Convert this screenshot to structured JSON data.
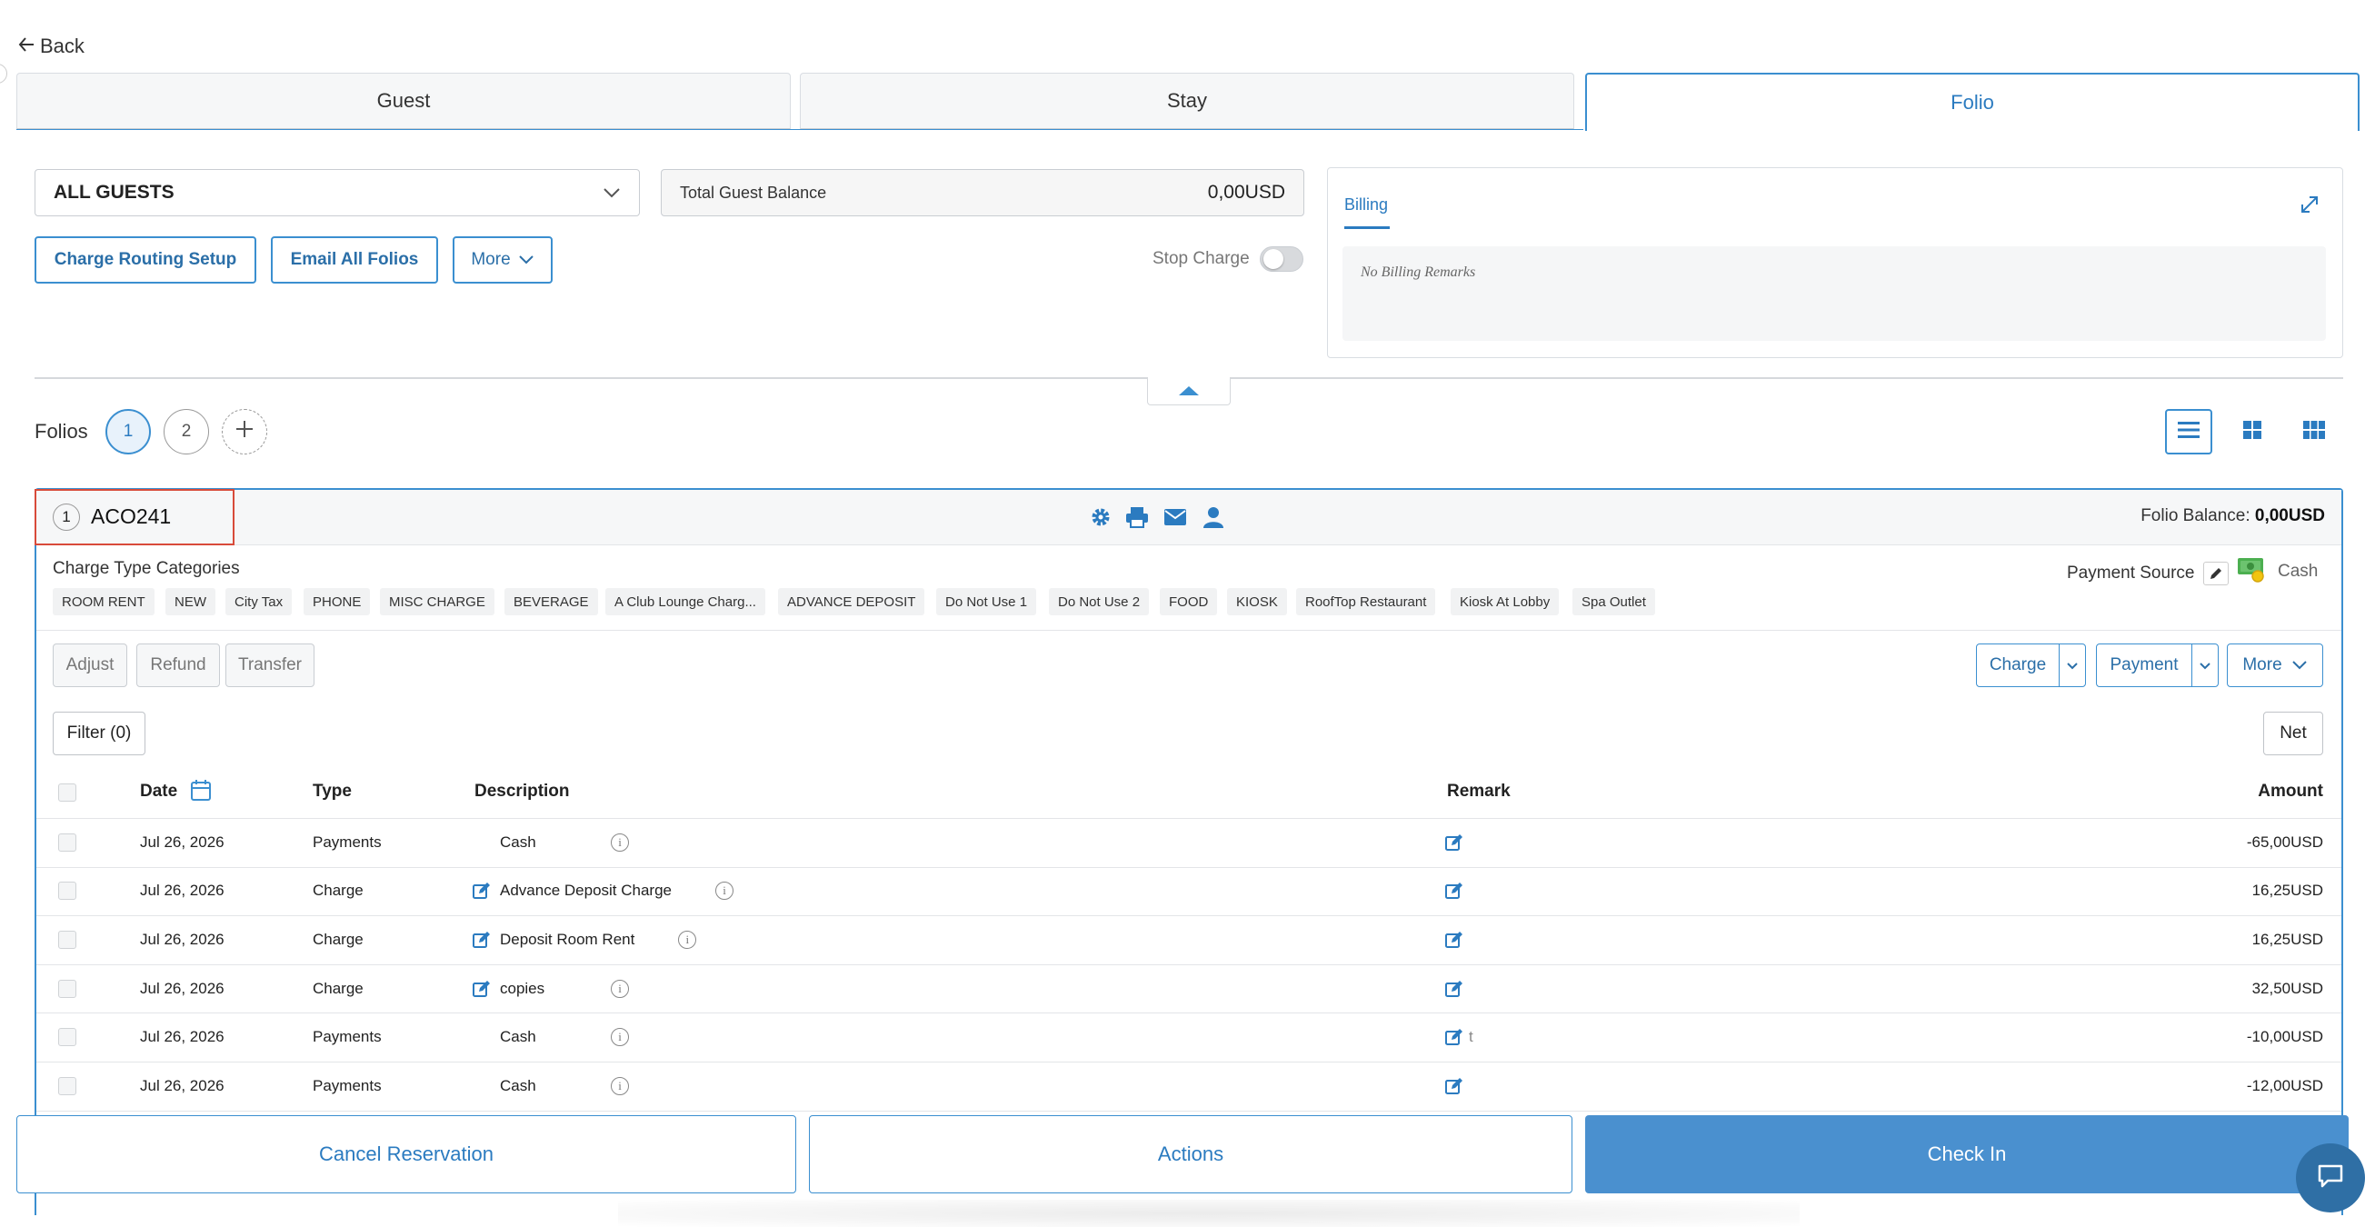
{
  "nav": {
    "back_label": "Back"
  },
  "tabs": [
    {
      "label": "Guest"
    },
    {
      "label": "Stay"
    },
    {
      "label": "Folio"
    }
  ],
  "guest_select": {
    "value": "ALL GUESTS"
  },
  "balance": {
    "label": "Total Guest Balance",
    "value": "0,00USD"
  },
  "actions_row": {
    "charge_routing": "Charge Routing Setup",
    "email_all": "Email All Folios",
    "more": "More",
    "stop_charge": "Stop Charge",
    "stop_charge_on": false
  },
  "billing": {
    "tab": "Billing",
    "remarks": "No Billing Remarks"
  },
  "folios": {
    "label": "Folios",
    "items": [
      "1",
      "2"
    ]
  },
  "folio": {
    "number": "1",
    "name": "ACO241",
    "balance_label": "Folio Balance:",
    "balance_value": "0,00USD",
    "charge_type_label": "Charge Type Categories",
    "categories": [
      "ROOM RENT",
      "NEW",
      "City Tax",
      "PHONE",
      "MISC CHARGE",
      "BEVERAGE",
      "A Club Lounge Charg...",
      "ADVANCE DEPOSIT",
      "Do Not Use 1",
      "Do Not Use 2",
      "FOOD",
      "KIOSK",
      "RoofTop Restaurant",
      "Kiosk At Lobby",
      "Spa Outlet"
    ],
    "payment_source_label": "Payment Source",
    "payment_source_value": "Cash"
  },
  "toolbar": {
    "adjust": "Adjust",
    "refund": "Refund",
    "transfer": "Transfer",
    "charge": "Charge",
    "payment": "Payment",
    "more": "More",
    "filter": "Filter (0)",
    "net": "Net"
  },
  "table": {
    "headers": {
      "date": "Date",
      "type": "Type",
      "description": "Description",
      "remark": "Remark",
      "amount": "Amount"
    },
    "rows": [
      {
        "date": "Jul 26, 2026",
        "type": "Payments",
        "description": "Cash",
        "remark": "",
        "amount": "-65,00USD",
        "editable": false
      },
      {
        "date": "Jul 26, 2026",
        "type": "Charge",
        "description": "Advance Deposit Charge",
        "remark": "",
        "amount": "16,25USD",
        "editable": true
      },
      {
        "date": "Jul 26, 2026",
        "type": "Charge",
        "description": "Deposit Room Rent",
        "remark": "",
        "amount": "16,25USD",
        "editable": true
      },
      {
        "date": "Jul 26, 2026",
        "type": "Charge",
        "description": "copies",
        "remark": "",
        "amount": "32,50USD",
        "editable": true
      },
      {
        "date": "Jul 26, 2026",
        "type": "Payments",
        "description": "Cash",
        "remark": "t",
        "amount": "-10,00USD",
        "editable": false
      },
      {
        "date": "Jul 26, 2026",
        "type": "Payments",
        "description": "Cash",
        "remark": "",
        "amount": "-12,00USD",
        "editable": false
      }
    ]
  },
  "bottom": {
    "cancel": "Cancel Reservation",
    "actions": "Actions",
    "check_in": "Check In"
  },
  "colors": {
    "accent": "#3b8fd0",
    "highlight": "#d84b3a",
    "check_in_bg": "#4a90cf"
  }
}
